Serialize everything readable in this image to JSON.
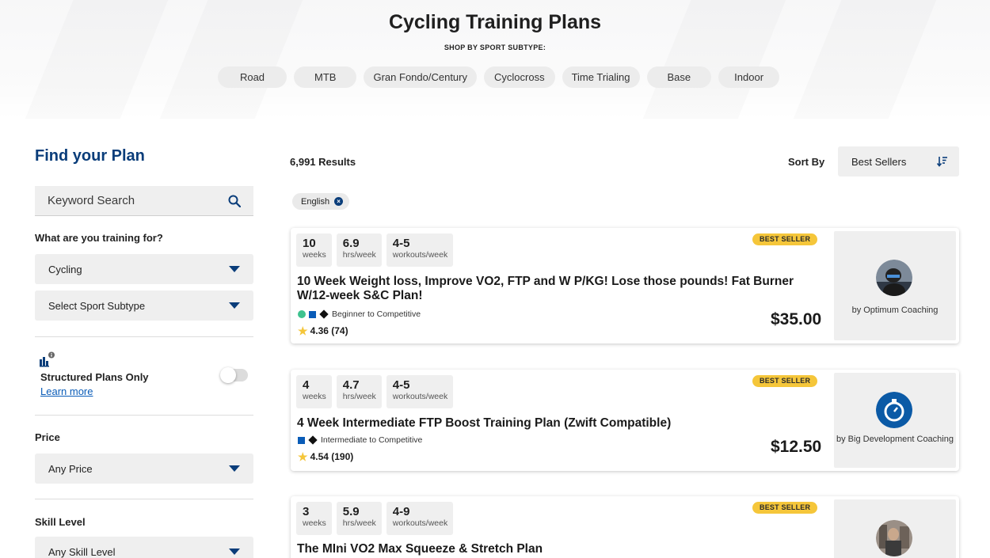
{
  "hero": {
    "title": "Cycling Training Plans",
    "subtitle": "SHOP BY SPORT SUBTYPE:",
    "subtypes": [
      "Road",
      "MTB",
      "Gran Fondo/Century",
      "Cyclocross",
      "Time Trialing",
      "Base",
      "Indoor"
    ]
  },
  "sidebar": {
    "title": "Find your Plan",
    "search_placeholder": "Keyword Search",
    "training_for_label": "What are you training for?",
    "sport_value": "Cycling",
    "subtype_value": "Select Sport Subtype",
    "structured_label": "Structured Plans Only",
    "learn_more": "Learn more",
    "price_label": "Price",
    "price_value": "Any Price",
    "skill_label": "Skill Level",
    "skill_value": "Any Skill Level"
  },
  "results": {
    "count": "6,991 Results",
    "sort_label": "Sort By",
    "sort_value": "Best Sellers",
    "filter_chip": "English"
  },
  "plans": [
    {
      "weeks": "10",
      "hours": "6.9",
      "workouts": "4-5",
      "weeks_unit": "weeks",
      "hours_unit": "hrs/week",
      "workouts_unit": "workouts/week",
      "badge": "BEST SELLER",
      "title": "10 Week Weight loss, Improve VO2, FTP and W P/KG! Lose those pounds! Fat Burner W/12-week S&C Plan!",
      "skill": "Beginner to Competitive",
      "rating": "4.36 (74)",
      "price": "$35.00",
      "coach": "by Optimum Coaching"
    },
    {
      "weeks": "4",
      "hours": "4.7",
      "workouts": "4-5",
      "weeks_unit": "weeks",
      "hours_unit": "hrs/week",
      "workouts_unit": "workouts/week",
      "badge": "BEST SELLER",
      "title": "4 Week Intermediate FTP Boost Training Plan (Zwift Compatible)",
      "skill": "Intermediate to Competitive",
      "rating": "4.54 (190)",
      "price": "$12.50",
      "coach": "by Big Development Coaching"
    },
    {
      "weeks": "3",
      "hours": "5.9",
      "workouts": "4-9",
      "weeks_unit": "weeks",
      "hours_unit": "hrs/week",
      "workouts_unit": "workouts/week",
      "badge": "BEST SELLER",
      "title": "The MIni VO2 Max Squeeze & Stretch Plan"
    }
  ],
  "colors": {
    "brand": "#0a3d7a",
    "badge": "#f5c63a",
    "link": "#0a5cb8"
  }
}
